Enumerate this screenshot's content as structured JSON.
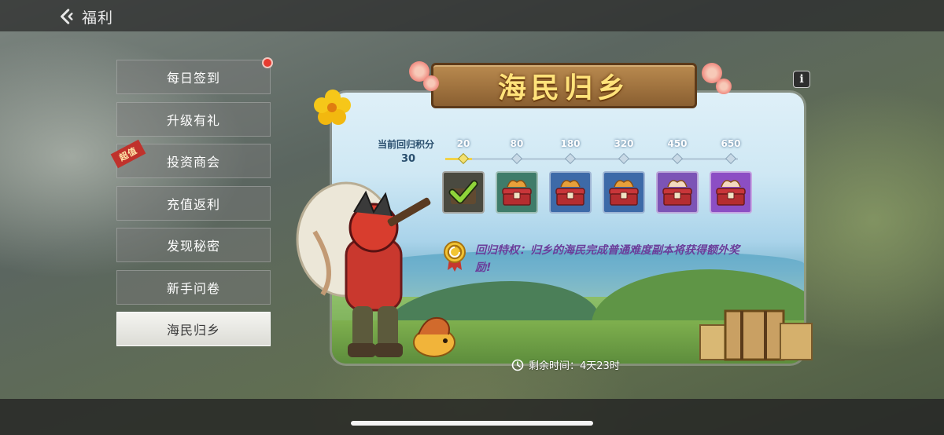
{
  "header": {
    "title": "福利"
  },
  "menu": {
    "items": [
      {
        "label": "每日签到",
        "has_dot": true
      },
      {
        "label": "升级有礼"
      },
      {
        "label": "投资商会",
        "ribbon": "超值"
      },
      {
        "label": "充值返利"
      },
      {
        "label": "发现秘密"
      },
      {
        "label": "新手问卷"
      },
      {
        "label": "海民归乡",
        "active": true
      }
    ]
  },
  "event": {
    "title": "海民归乡",
    "score_label": "当前回归积分",
    "score_value": "30",
    "milestones": [
      "20",
      "80",
      "180",
      "320",
      "450",
      "650"
    ],
    "chest_states": [
      "claimed",
      "green",
      "blue",
      "blue",
      "purple",
      "violet"
    ],
    "privilege": "回归特权：归乡的海民完成普通难度副本将获得额外奖励!",
    "timer": "剩余时间：4天23时",
    "info_icon": "i"
  },
  "colors": {
    "accent_title": "#ffe27a",
    "privilege_text": "#6b3d9a",
    "red_dot": "#e73b30"
  },
  "icons": [
    "back-arrow-icon",
    "info-icon",
    "check-icon",
    "chest-icon",
    "medal-icon",
    "clock-icon"
  ]
}
